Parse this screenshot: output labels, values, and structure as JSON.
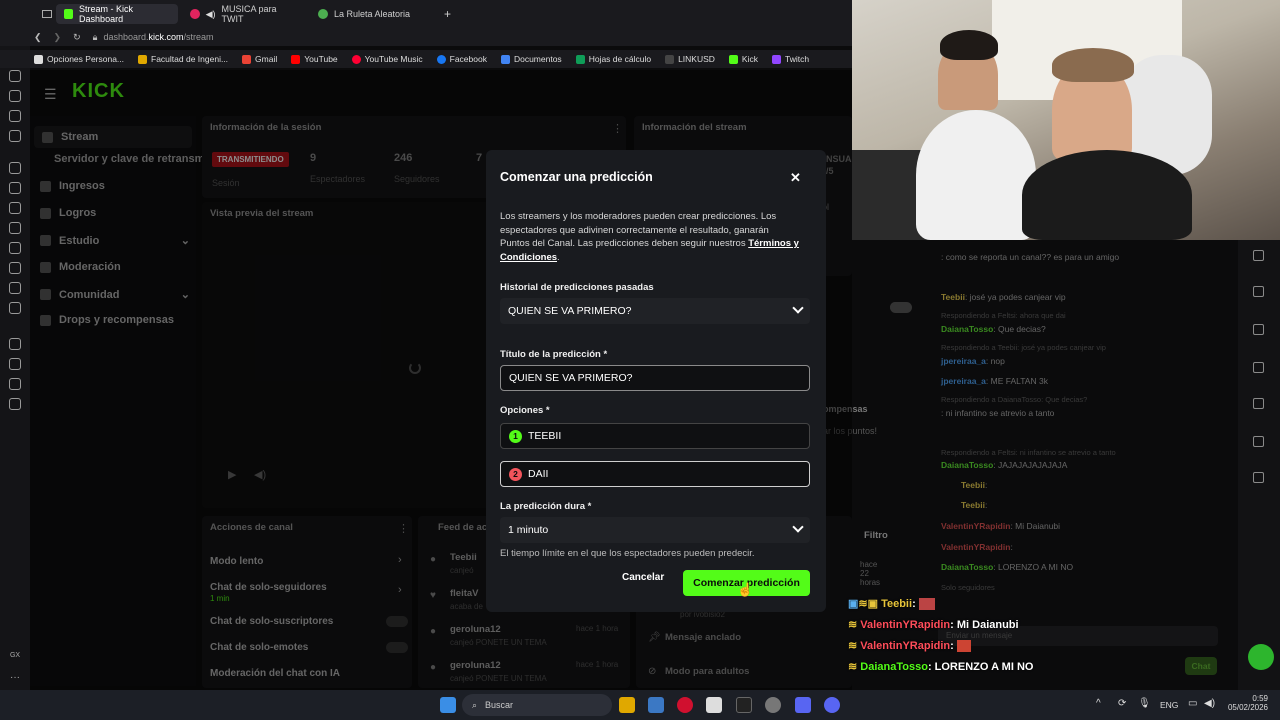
{
  "tabs": [
    {
      "label": "Stream - Kick Dashboard",
      "color": "#53fc18"
    },
    {
      "label": "MUSICA para TWIT",
      "color": "#e0245e"
    },
    {
      "label": "La Ruleta Aleatoria",
      "color": "#4caf50"
    }
  ],
  "address": {
    "url_domain": "dashboard.",
    "url_host": "kick.com",
    "url_path": "/stream"
  },
  "bookmarks": [
    "Opciones Persona...",
    "Facultad de Ingeni...",
    "Gmail",
    "YouTube",
    "YouTube Music",
    "Facebook",
    "Documentos",
    "Hojas de cálculo",
    "LINKUSD",
    "Kick",
    "Twitch"
  ],
  "kick": {
    "logo": "KICK",
    "nav": [
      {
        "label": "Stream"
      },
      {
        "label": "Servidor y clave de retransm"
      },
      {
        "label": "Ingresos"
      },
      {
        "label": "Logros"
      },
      {
        "label": "Estudio"
      },
      {
        "label": "Moderación"
      },
      {
        "label": "Comunidad"
      },
      {
        "label": "Drops y recompensas"
      }
    ],
    "session": {
      "title": "Información de la sesión",
      "status": "TRANSMITIENDO",
      "status_sub": "Sesión",
      "viewers": "9",
      "viewers_label": "Espectadores",
      "followers": "246",
      "followers_label": "Seguidores",
      "third": "7"
    },
    "stream_info": {
      "title": "Información del stream",
      "partial_1": "NSUA",
      "partial_2": "/5",
      "partial_3": "ol"
    },
    "preview": {
      "title": "Vista previa del stream"
    },
    "rewards": {
      "partial_1": "ompensas",
      "partial_2": "ar los puntos!"
    },
    "actions": {
      "title": "Acciones de canal",
      "items": [
        "Modo lento",
        "Chat de solo-seguidores",
        "1 min",
        "Chat de solo-suscriptores",
        "Chat de solo-emotes",
        "Moderación del chat con IA"
      ]
    },
    "feed": {
      "title": "Feed de ac",
      "items": [
        {
          "user": "Teebii",
          "sub": "canjeó",
          "time": "hace 22 horas"
        },
        {
          "user": "fleitaV",
          "sub": "acaba de",
          "time": ""
        },
        {
          "user": "geroluna12",
          "sub": "canjeó PONETE UN TEMA",
          "time": "hace 1 hora"
        },
        {
          "user": "geroluna12",
          "sub": "canjeó PONETE UN TEMA",
          "time": "hace 1 hora"
        }
      ],
      "filter": "Filtro",
      "pinned": "Mensaje anclado",
      "pinned_sub": "por ivobisio",
      "adult": "Modo para adultos",
      "pinned_sub2": "por ivobisio2"
    }
  },
  "modal": {
    "title": "Comenzar una predicción",
    "desc": "Los streamers y los moderadores pueden crear predicciones. Los espectadores que adivinen correctamente el resultado, ganarán Puntos del Canal. Las predicciones deben seguir nuestros",
    "terms": "Términos y Condiciones",
    "terms_suffix": ".",
    "history_label": "Historial de predicciones pasadas",
    "history_value": "QUIEN SE VA PRIMERO?",
    "title_label": "Título de la predicción *",
    "title_value": "QUIEN SE VA PRIMERO?",
    "options_label": "Opciones *",
    "option1_num": "1",
    "option1": "TEEBII",
    "option2_num": "2",
    "option2": "DAII",
    "duration_label": "La predicción dura *",
    "duration_value": "1 minuto",
    "duration_hint": "El tiempo límite en el que los espectadores pueden predecir.",
    "cancel": "Cancelar",
    "submit": "Comenzar predicción",
    "colors": {
      "accent": "#53fc18",
      "option2": "#f2545b",
      "panel": "#191b1f"
    }
  },
  "chat": [
    {
      "name": "",
      "text": ": como se reporta un canal?? es para un amigo",
      "color": "#b33"
    },
    {
      "name": "Teebii",
      "text": ": josé ya podes canjear vip",
      "color": "#e8c53a"
    },
    {
      "name": "",
      "text": "Respondiendo a Feltsi: ahora que dai",
      "color": "#555"
    },
    {
      "name": "DaianaTosso",
      "text": ": Que decias?",
      "color": "#53fc18"
    },
    {
      "name": "",
      "text": "Respondiendo a Teebii: josé ya podes canjear vip",
      "color": "#555"
    },
    {
      "name": "jpereiraa_a",
      "text": ": nop",
      "color": "#3c8bd9"
    },
    {
      "name": "jpereiraa_a",
      "text": ": ME FALTAN 3k",
      "color": "#3c8bd9"
    },
    {
      "name": "",
      "text": "Respondiendo a DaianaTosso: Que decias?",
      "color": "#555"
    },
    {
      "name": "",
      "text": ": ni infantino se atrevio a tanto",
      "color": "#b33"
    },
    {
      "name": "",
      "text": "Respondiendo a Feltsi: ni infantino se atrevio a tanto",
      "color": "#555"
    },
    {
      "name": "DaianaTosso",
      "text": ": JAJAJAJAJAJAJA",
      "color": "#53fc18"
    },
    {
      "name": "Teebii",
      "text": ":",
      "color": "#e8c53a"
    },
    {
      "name": "Teebii",
      "text": ":",
      "color": "#e8c53a"
    },
    {
      "name": "ValentinYRapidin",
      "text": ": Mi Daianubi",
      "color": "#b33"
    },
    {
      "name": "ValentinYRapidin",
      "text": ":",
      "color": "#b33"
    },
    {
      "name": "DaianaTosso",
      "text": ": LORENZO A MI NO",
      "color": "#53fc18"
    }
  ],
  "chat_footer": {
    "placeholder": "Enviar un mensaje",
    "button": "Chat",
    "seguidores": "Solo seguidores"
  },
  "overlay_chat": [
    {
      "name": "Teebii",
      "text": ":",
      "color": "#e8c53a"
    },
    {
      "name": "ValentinYRapidin",
      "text": ": Mi Daianubi",
      "color": "#ff4d5a"
    },
    {
      "name": "ValentinYRapidin",
      "text": ":",
      "color": "#ff4d5a"
    },
    {
      "name": "DaianaTosso",
      "text": ": LORENZO A MI NO",
      "color": "#53fc18"
    }
  ],
  "taskbar": {
    "search": "Buscar",
    "lang": "ENG",
    "time": "0:59",
    "date": "05/02/2026"
  }
}
